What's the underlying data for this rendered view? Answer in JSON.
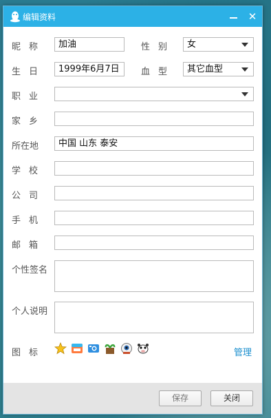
{
  "window": {
    "title": "编辑资料"
  },
  "form": {
    "nickname": {
      "label": "昵称",
      "value": "加油"
    },
    "gender": {
      "label": "性别",
      "value": "女"
    },
    "birthday": {
      "label": "生日",
      "value": "1999年6月7日"
    },
    "blood": {
      "label": "血型",
      "value": "其它血型"
    },
    "job": {
      "label": "职业",
      "value": ""
    },
    "hometown": {
      "label": "家乡",
      "value": ""
    },
    "location": {
      "label": "所在地",
      "value": "中国  山东  泰安"
    },
    "school": {
      "label": "学校",
      "value": ""
    },
    "company": {
      "label": "公司",
      "value": ""
    },
    "phone": {
      "label": "手机",
      "value": ""
    },
    "email": {
      "label": "邮箱",
      "value": ""
    },
    "signature": {
      "label": "个性签名",
      "value": ""
    },
    "description": {
      "label": "个人说明",
      "value": ""
    },
    "icons": {
      "label": "图标",
      "items": [
        "star-icon",
        "app-icon",
        "camera-icon",
        "plant-icon",
        "eyeball-icon",
        "cow-icon"
      ],
      "manage_label": "管理"
    }
  },
  "footer": {
    "save_label": "保存",
    "close_label": "关闭"
  },
  "colors": {
    "titlebar": "#2cb1e6",
    "link": "#1c8fce"
  }
}
